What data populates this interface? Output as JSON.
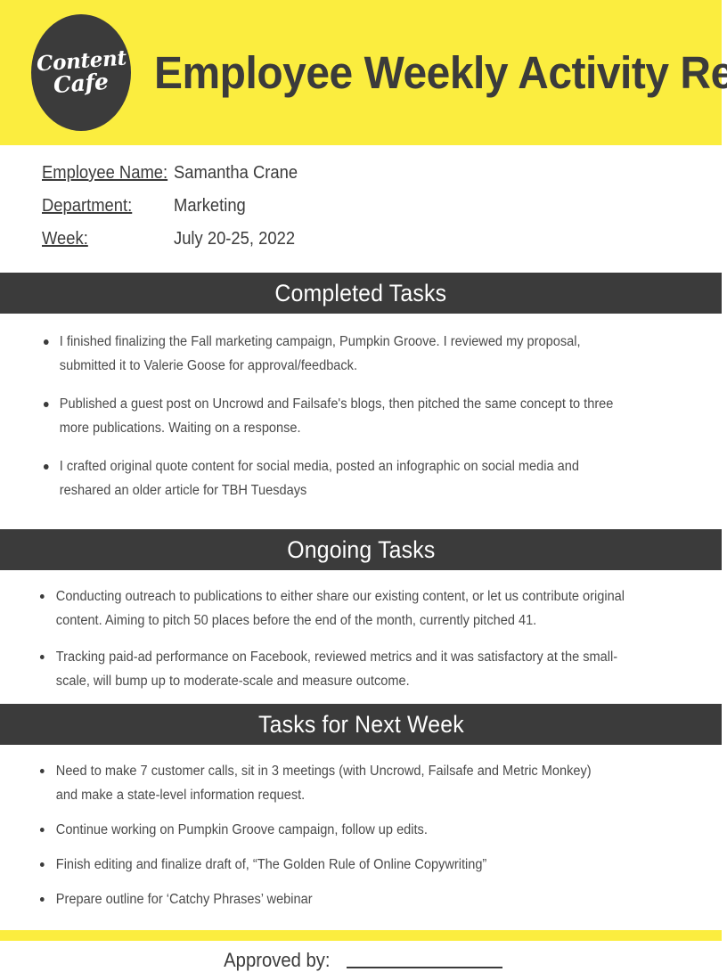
{
  "header": {
    "logo": {
      "line1": "Content",
      "line2": "Cafe"
    },
    "title": "Employee Weekly Activity Report",
    "background_color": "#fbed3f",
    "logo_color": "#3b3b3b"
  },
  "info": {
    "rows": [
      {
        "label": "Employee Name:",
        "value": "Samantha Crane"
      },
      {
        "label": "Department:",
        "value": "Marketing"
      },
      {
        "label": "Week:",
        "value": "July 20-25, 2022"
      }
    ]
  },
  "sections": [
    {
      "title": "Completed Tasks",
      "items": [
        "I finished finalizing the Fall marketing campaign, Pumpkin Groove. I reviewed my proposal, submitted it to Valerie Goose for approval/feedback.",
        "Published a guest post on Uncrowd and Failsafe's blogs, then pitched the same concept to three more publications. Waiting on a response.",
        "I crafted original quote content for social media, posted an infographic on social media and reshared an older article for TBH Tuesdays"
      ]
    },
    {
      "title": "Ongoing Tasks",
      "items": [
        "Conducting outreach to publications to either share our existing content, or let us contribute original content. Aiming to pitch 50 places before the end of the month, currently pitched 41.",
        "Tracking paid-ad performance on Facebook, reviewed metrics and it was satisfactory at the small-scale, will bump up to moderate-scale and measure outcome."
      ]
    },
    {
      "title": "Tasks for Next Week",
      "items": [
        "Need to make 7 customer calls, sit in 3 meetings (with Uncrowd, Failsafe and Metric Monkey) and make a state-level information request.",
        "Continue working on Pumpkin Groove campaign, follow up edits.",
        "Finish editing and finalize draft of, “The Golden Rule of Online Copywriting”",
        "Prepare outline for ‘Catchy Phrases’ webinar"
      ]
    }
  ],
  "approval": {
    "label": "Approved by:",
    "signature_value": ""
  },
  "colors": {
    "accent_yellow": "#fbed3f",
    "dark": "#3b3b3b",
    "body_text": "#4a4a4a"
  }
}
